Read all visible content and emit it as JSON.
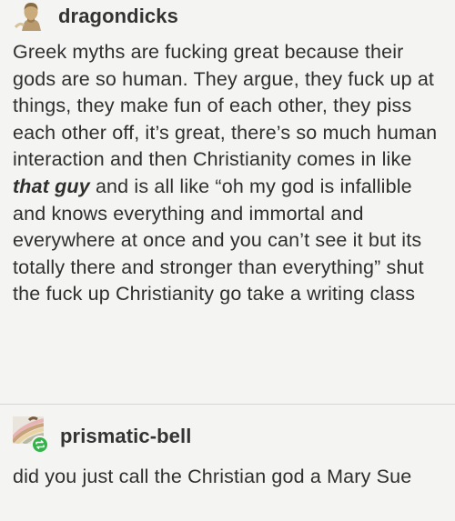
{
  "posts": [
    {
      "username": "dragondicks",
      "avatar_icon": "bust-portrait-icon",
      "text_parts": {
        "before": "Greek myths are fucking great because their gods are so human. They argue, they fuck up at things, they make fun of each other, they piss each other off, it’s great, there’s so much human interaction and then Christianity comes in like ",
        "emphasis_1": "that",
        "space": " ",
        "emphasis_2": "guy",
        "after": " and is all like “oh my god is infallible and knows everything and immortal and everywhere at once and you can’t see it but its totally there and stronger than everything” shut the fuck up Christianity go take a writing class"
      }
    },
    {
      "username": "prismatic-bell",
      "avatar_icon": "rainbow-stripes-icon",
      "badge_icon": "reblog-icon",
      "text": "did you just call the Christian god a Mary Sue"
    }
  ],
  "colors": {
    "background": "#f4f4f2",
    "text": "#2f2f2f",
    "reblog_badge": "#35b34a"
  }
}
